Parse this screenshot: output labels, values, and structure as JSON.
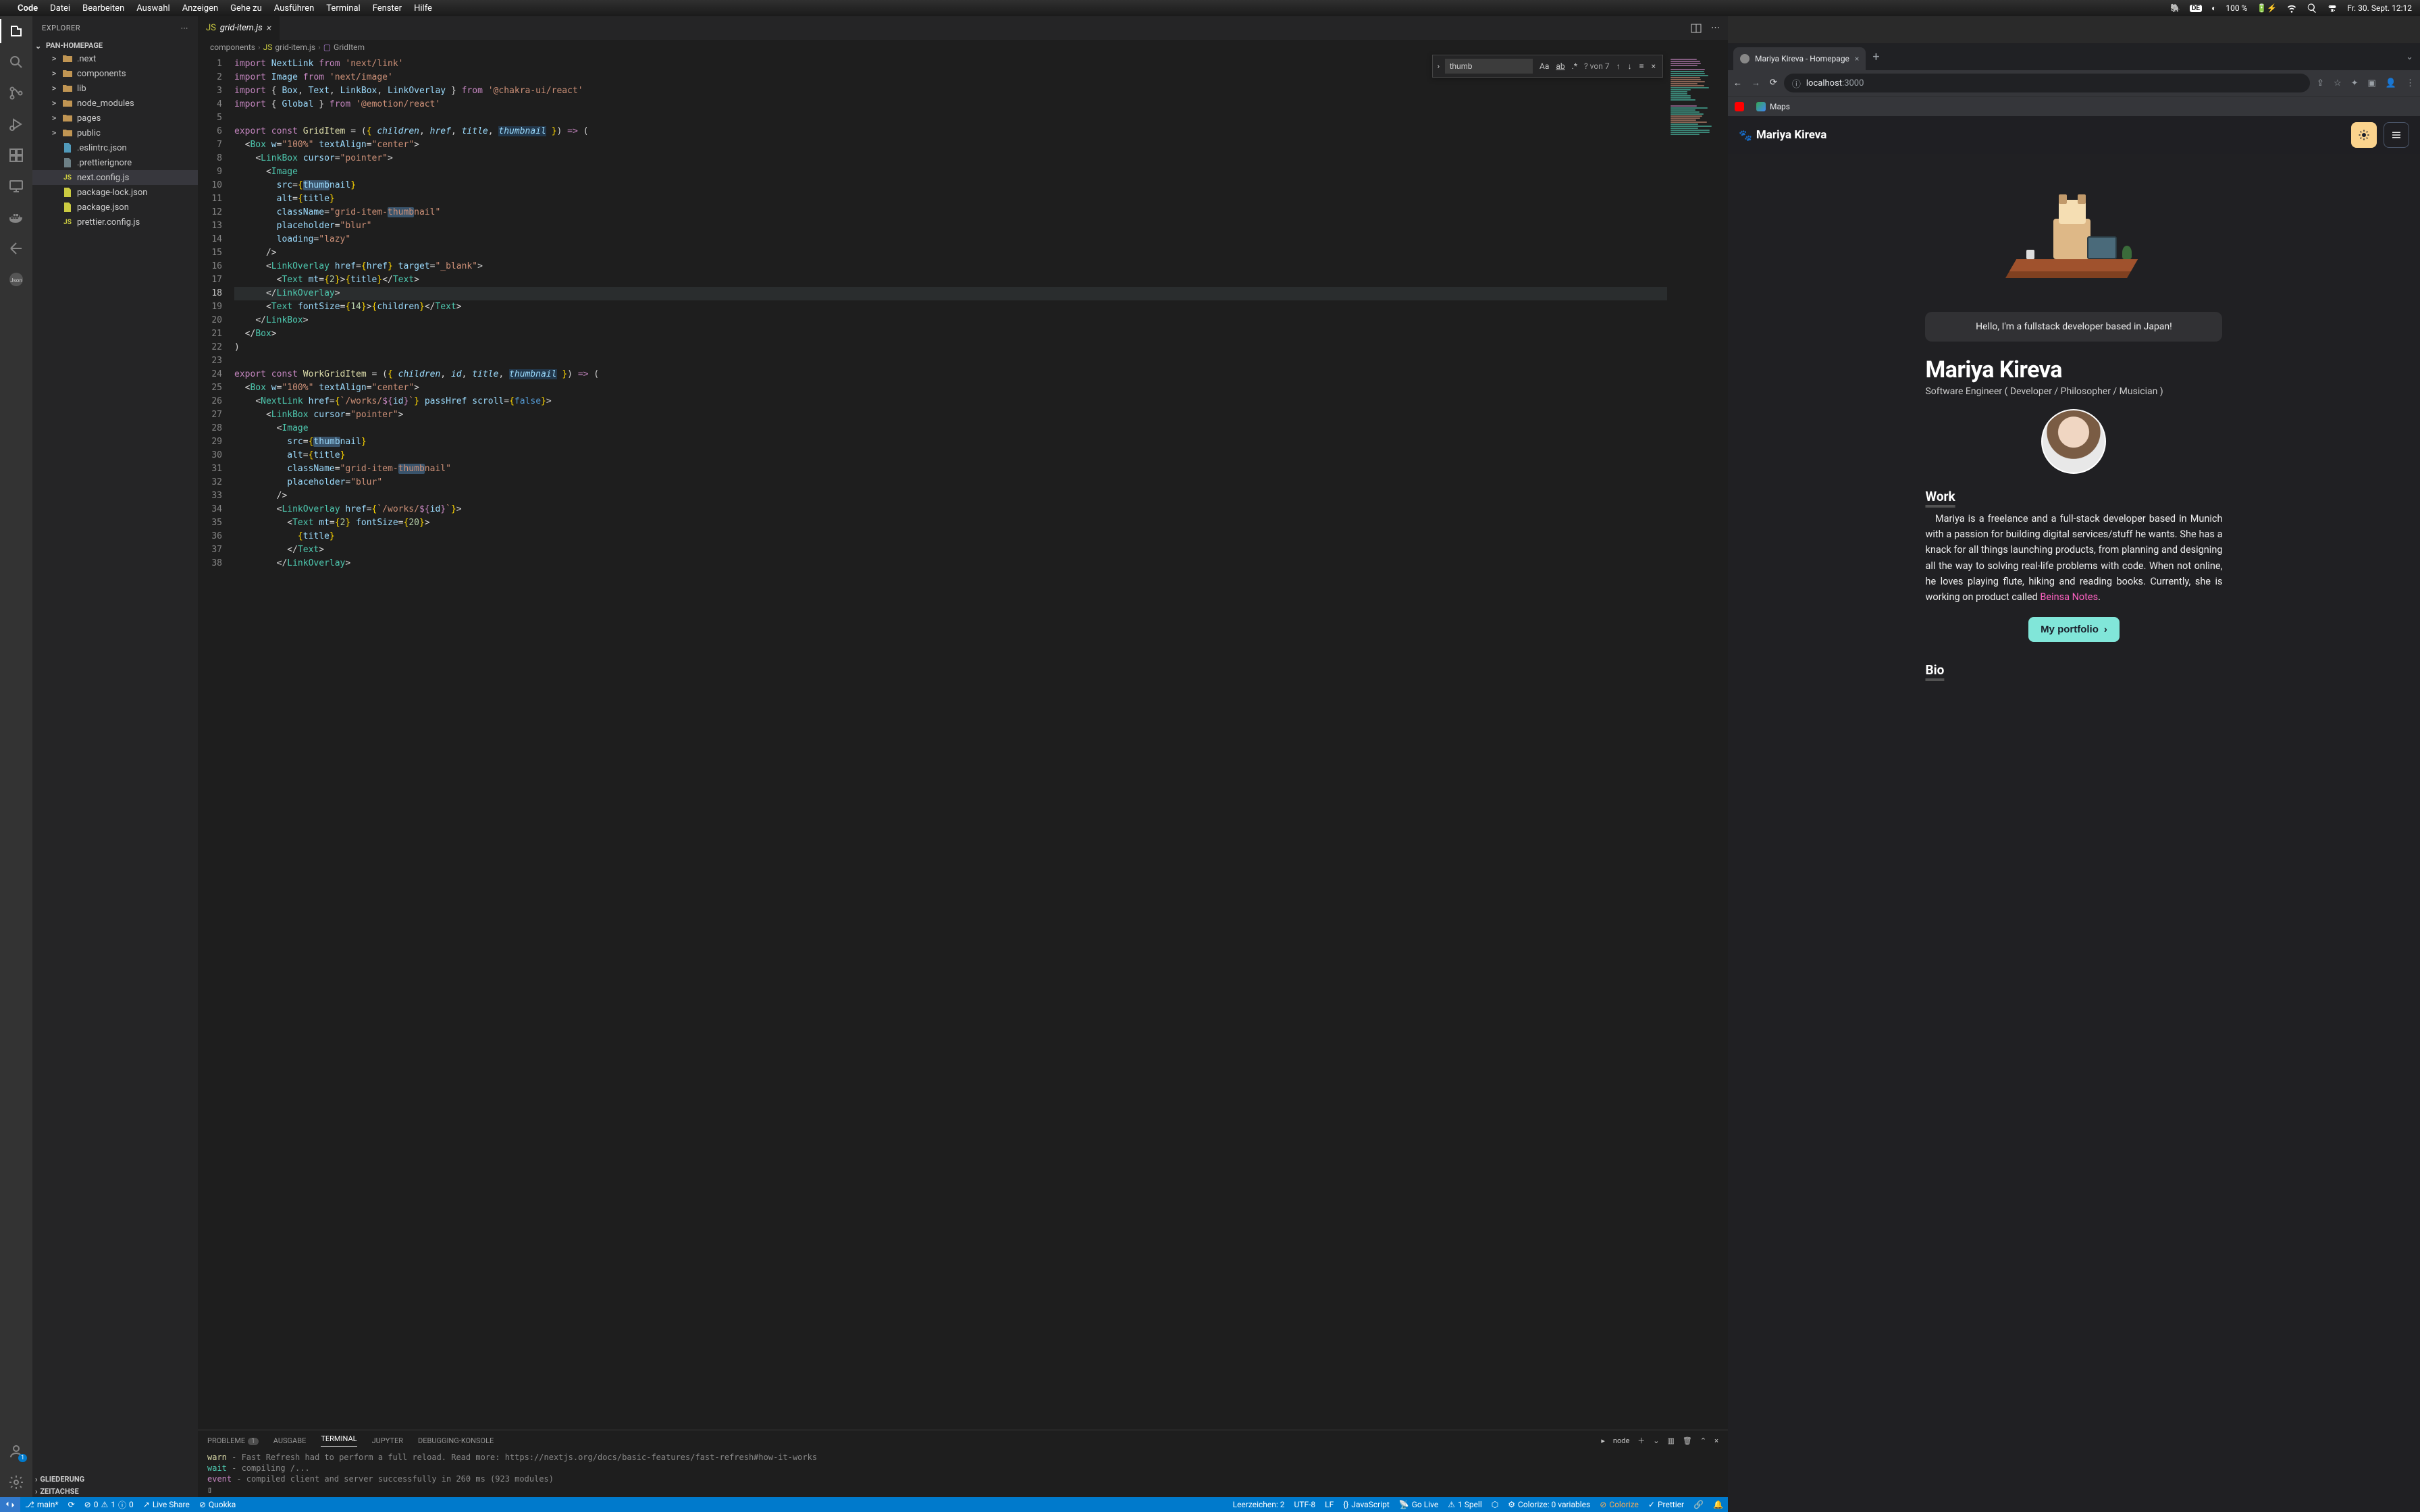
{
  "mac": {
    "app": "Code",
    "menus": [
      "Datei",
      "Bearbeiten",
      "Auswahl",
      "Anzeigen",
      "Gehe zu",
      "Ausführen",
      "Terminal",
      "Fenster",
      "Hilfe"
    ],
    "lang": "DE",
    "battery": "100 %",
    "clock": "Fr. 30. Sept.  12:12"
  },
  "sidebar": {
    "title": "EXPLORER",
    "workspace": "PAN-HOMEPAGE",
    "tree": [
      {
        "indent": 1,
        "chev": ">",
        "icon": "folder",
        "iconColor": "#c09553",
        "label": ".next"
      },
      {
        "indent": 1,
        "chev": ">",
        "icon": "folder",
        "iconColor": "#c09553",
        "label": "components"
      },
      {
        "indent": 1,
        "chev": ">",
        "icon": "folder",
        "iconColor": "#c09553",
        "label": "lib"
      },
      {
        "indent": 1,
        "chev": ">",
        "icon": "folder",
        "iconColor": "#c09553",
        "label": "node_modules"
      },
      {
        "indent": 1,
        "chev": ">",
        "icon": "folder",
        "iconColor": "#c09553",
        "label": "pages"
      },
      {
        "indent": 1,
        "chev": ">",
        "icon": "folder",
        "iconColor": "#c09553",
        "label": "public"
      },
      {
        "indent": 1,
        "chev": "",
        "icon": "file",
        "iconColor": "#519aba",
        "label": ".eslintrc.json"
      },
      {
        "indent": 1,
        "chev": "",
        "icon": "file",
        "iconColor": "#6d8086",
        "label": ".prettierignore"
      },
      {
        "indent": 1,
        "chev": "",
        "icon": "js",
        "iconColor": "#cbcb41",
        "label": "next.config.js",
        "selected": true
      },
      {
        "indent": 1,
        "chev": "",
        "icon": "file",
        "iconColor": "#cbcb41",
        "label": "package-lock.json"
      },
      {
        "indent": 1,
        "chev": "",
        "icon": "file",
        "iconColor": "#cbcb41",
        "label": "package.json"
      },
      {
        "indent": 1,
        "chev": "",
        "icon": "js",
        "iconColor": "#cbcb41",
        "label": "prettier.config.js"
      }
    ],
    "bottom1": "GLIEDERUNG",
    "bottom2": "ZEITACHSE"
  },
  "tabs": {
    "file": "grid-item.js"
  },
  "breadcrumbs": [
    "components",
    "grid-item.js",
    "GridItem"
  ],
  "find": {
    "value": "thumb",
    "count": "? von 7"
  },
  "panel": {
    "tabs": {
      "problems": "PROBLEME",
      "problems_badge": "1",
      "output": "AUSGABE",
      "terminal": "TERMINAL",
      "jupyter": "JUPYTER",
      "debug": "DEBUGGING-KONSOLE"
    },
    "proc": "node",
    "lines": {
      "l1a": "warn",
      "l1b": "  - Fast Refresh had to perform a full reload. Read more: https://nextjs.org/docs/basic-features/fast-refresh#how-it-works",
      "l2a": "wait",
      "l2b": "  - compiling /...",
      "l3a": "event",
      "l3b": " - compiled client and server successfully in 260 ms (923 modules)",
      "l4": "▯"
    }
  },
  "status": {
    "branch": "main*",
    "sync": "⟳",
    "err": "0",
    "warn": "1",
    "info": "0",
    "live": "Live Share",
    "quokka": "Quokka",
    "line": "Leerzeichen: 2",
    "enc": "UTF-8",
    "eol": "LF",
    "lang": "JavaScript",
    "golive": "Go Live",
    "spell": "1 Spell",
    "colorize": "Colorize: 0 variables",
    "colorize2": "Colorize",
    "prettier": "Prettier"
  },
  "browser": {
    "tab": "Mariya Kireva - Homepage",
    "url_host": "localhost",
    "url_port": ":3000",
    "bookmarks": [
      {
        "color": "#ff0000",
        "label": ""
      },
      {
        "color": "#34a853",
        "label": "Maps"
      }
    ]
  },
  "site": {
    "logo": "Mariya Kireva",
    "hello": "Hello, I'm a fullstack developer based in Japan!",
    "name": "Mariya Kireva",
    "role": "Software Engineer ( Developer / Philosopher / Musician )",
    "work_h": "Work",
    "work_p": "Mariya is a freelance and a full-stack developer based in Munich with a passion for building digital services/stuff he wants. She has a knack for all things launching products, from planning and designing all the way to solving real-life problems with code. When not online, he loves playing flute, hiking and reading books. Currently, she is working on product called ",
    "work_link": "Beinsa Notes",
    "work_period": ".",
    "portfolio": "My portfolio",
    "bio_h": "Bio"
  }
}
